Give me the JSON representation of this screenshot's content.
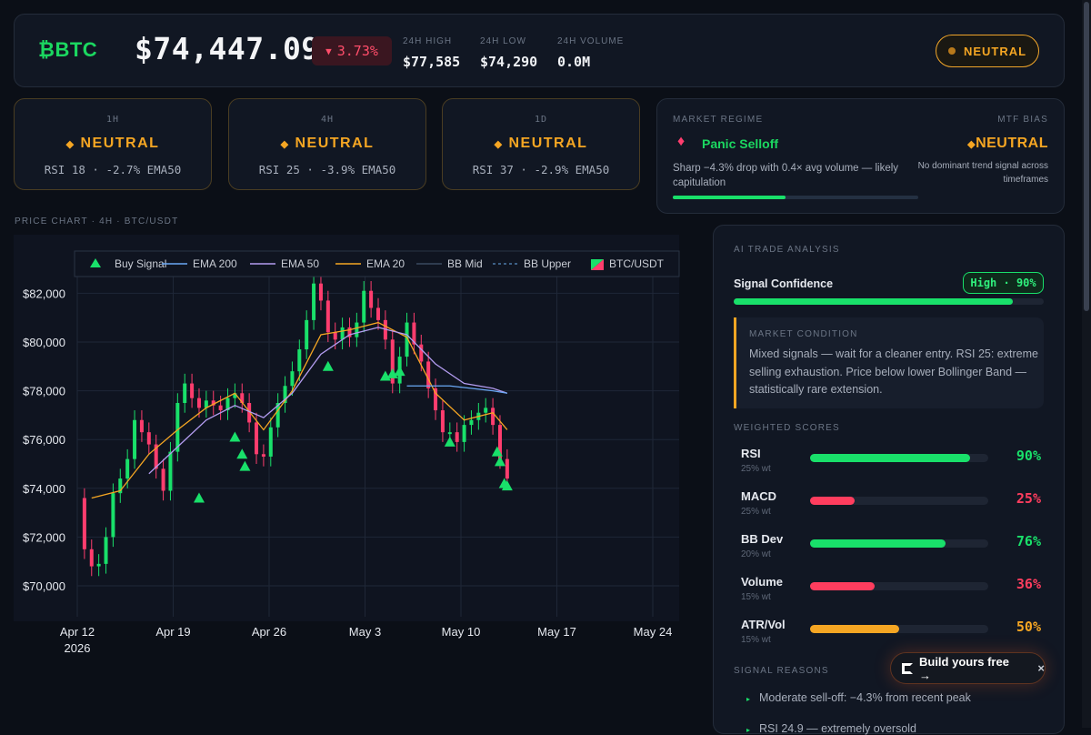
{
  "header": {
    "symbol": "BTC",
    "price": "$74,447.09",
    "change": "3.73%",
    "stats": [
      {
        "label": "24H HIGH",
        "value": "$77,585"
      },
      {
        "label": "24H LOW",
        "value": "$74,290"
      },
      {
        "label": "24H VOLUME",
        "value": "0.0M"
      }
    ],
    "bias_badge": "NEUTRAL"
  },
  "timeframes": [
    {
      "tf": "1H",
      "signal": "NEUTRAL",
      "detail": "RSI 18 · -2.7% EMA50"
    },
    {
      "tf": "4H",
      "signal": "NEUTRAL",
      "detail": "RSI 25 · -3.9% EMA50"
    },
    {
      "tf": "1D",
      "signal": "NEUTRAL",
      "detail": "RSI 37 · -2.9% EMA50"
    }
  ],
  "regime": {
    "title": "MARKET REGIME",
    "name": "Panic Selloff",
    "description": "Sharp −4.3% drop with 0.4× avg volume — likely capitulation",
    "progress": 0.46,
    "mtf_title": "MTF BIAS",
    "mtf_value": "NEUTRAL",
    "mtf_note": "No dominant trend signal across timeframes"
  },
  "chart_title": "PRICE CHART · 4H · BTC/USDT",
  "chart_data": {
    "type": "line",
    "title": "",
    "xlabel": "",
    "ylabel": "",
    "x_ticks": [
      "Apr 12",
      "Apr 19",
      "Apr 26",
      "May 3",
      "May 10",
      "May 17",
      "May 24"
    ],
    "x_tick_sub": "2026",
    "y_ticks": [
      "$70,000",
      "$72,000",
      "$74,000",
      "$76,000",
      "$78,000",
      "$80,000",
      "$82,000"
    ],
    "ylim": [
      69000,
      83500
    ],
    "xlim": [
      0,
      42
    ],
    "legend": [
      "Buy Signal",
      "EMA 200",
      "EMA 50",
      "EMA 20",
      "BB Mid",
      "BB Upper",
      "BTC/USDT"
    ],
    "legend_position": "top",
    "series": [
      {
        "name": "BTC/USDT",
        "values": [
          [
            0,
            73600
          ],
          [
            0.5,
            71500
          ],
          [
            1,
            70800
          ],
          [
            1.5,
            70900
          ],
          [
            2,
            72000
          ],
          [
            2.5,
            73800
          ],
          [
            3,
            74400
          ],
          [
            3.5,
            75200
          ],
          [
            4,
            76800
          ],
          [
            4.5,
            76300
          ],
          [
            5,
            75800
          ],
          [
            5.5,
            74800
          ],
          [
            6,
            73900
          ],
          [
            6.5,
            75500
          ],
          [
            7,
            77500
          ],
          [
            7.5,
            78300
          ],
          [
            8,
            77700
          ],
          [
            8.5,
            77300
          ],
          [
            9,
            77600
          ],
          [
            9.5,
            77400
          ],
          [
            10,
            77200
          ],
          [
            10.5,
            77700
          ],
          [
            11,
            77900
          ],
          [
            11.5,
            77500
          ],
          [
            12,
            76700
          ],
          [
            12.5,
            75400
          ],
          [
            13,
            75300
          ],
          [
            13.5,
            76500
          ],
          [
            14,
            77500
          ],
          [
            14.5,
            78200
          ],
          [
            15,
            78800
          ],
          [
            15.5,
            79700
          ],
          [
            16,
            80900
          ],
          [
            16.5,
            82400
          ],
          [
            17,
            81700
          ],
          [
            17.5,
            80400
          ],
          [
            18,
            80100
          ],
          [
            18.5,
            80600
          ],
          [
            19,
            80200
          ],
          [
            19.5,
            80800
          ],
          [
            20,
            82100
          ],
          [
            20.5,
            81400
          ],
          [
            21,
            80900
          ],
          [
            21.5,
            80100
          ],
          [
            22,
            78300
          ],
          [
            22.5,
            79400
          ],
          [
            23,
            80800
          ],
          [
            23.5,
            79900
          ],
          [
            24,
            79200
          ],
          [
            24.5,
            78100
          ],
          [
            25,
            77200
          ],
          [
            25.5,
            76300
          ],
          [
            26,
            76300
          ],
          [
            26.5,
            75900
          ],
          [
            27,
            76600
          ],
          [
            27.5,
            76800
          ],
          [
            28,
            77100
          ],
          [
            28.5,
            77300
          ],
          [
            29,
            76600
          ],
          [
            29.5,
            75200
          ],
          [
            30,
            74400
          ]
        ]
      },
      {
        "name": "EMA 20",
        "values": [
          [
            1,
            73600
          ],
          [
            3,
            73900
          ],
          [
            5,
            75400
          ],
          [
            7,
            76400
          ],
          [
            9,
            77300
          ],
          [
            11,
            77900
          ],
          [
            13,
            76400
          ],
          [
            15,
            78000
          ],
          [
            17,
            80300
          ],
          [
            19,
            80500
          ],
          [
            21,
            80800
          ],
          [
            23,
            80200
          ],
          [
            25,
            77900
          ],
          [
            27,
            76800
          ],
          [
            29,
            77100
          ],
          [
            30,
            76400
          ]
        ]
      },
      {
        "name": "EMA 50",
        "values": [
          [
            5,
            74600
          ],
          [
            7,
            75700
          ],
          [
            9,
            76800
          ],
          [
            11,
            77400
          ],
          [
            13,
            76900
          ],
          [
            15,
            77900
          ],
          [
            17,
            79500
          ],
          [
            19,
            80300
          ],
          [
            21,
            80600
          ],
          [
            23,
            80300
          ],
          [
            25,
            79100
          ],
          [
            27,
            78300
          ],
          [
            29,
            78100
          ],
          [
            30,
            77900
          ]
        ]
      },
      {
        "name": "EMA 200",
        "values": [
          [
            23,
            78200
          ],
          [
            26,
            78200
          ],
          [
            29,
            78000
          ],
          [
            30,
            77900
          ]
        ]
      }
    ],
    "buy_signals": [
      [
        8.5,
        73600
      ],
      [
        17.5,
        79000
      ],
      [
        22,
        78700
      ],
      [
        22.5,
        78800
      ],
      [
        21.5,
        78600
      ],
      [
        11,
        76100
      ],
      [
        11.5,
        75400
      ],
      [
        11.7,
        74900
      ],
      [
        26,
        75900
      ],
      [
        29.3,
        75500
      ],
      [
        29.5,
        75100
      ],
      [
        29.8,
        74200
      ],
      [
        30,
        74100
      ]
    ]
  },
  "analysis": {
    "title": "AI TRADE ANALYSIS",
    "confidence_label": "Signal Confidence",
    "confidence_value": "High · 90%",
    "confidence_pct": 0.9,
    "condition_title": "MARKET CONDITION",
    "condition_text": "Mixed signals — wait for a cleaner entry. RSI 25: extreme selling exhaustion. Price below lower Bollinger Band — statistically rare extension.",
    "scores_title": "WEIGHTED SCORES",
    "scores": [
      {
        "name": "RSI",
        "weight": "25% wt",
        "value": "90%",
        "level": 0.9,
        "color": "#19e06a"
      },
      {
        "name": "MACD",
        "weight": "25% wt",
        "value": "25%",
        "level": 0.25,
        "color": "#ff3d5e"
      },
      {
        "name": "BB Dev",
        "weight": "20% wt",
        "value": "76%",
        "level": 0.76,
        "color": "#19e06a"
      },
      {
        "name": "Volume",
        "weight": "15% wt",
        "value": "36%",
        "level": 0.36,
        "color": "#ff3d5e"
      },
      {
        "name": "ATR/Vol",
        "weight": "15% wt",
        "value": "50%",
        "level": 0.5,
        "color": "#f5a623"
      }
    ],
    "reasons_title": "SIGNAL REASONS",
    "reasons": [
      "Moderate sell-off: −4.3% from recent peak",
      "RSI 24.9 — extremely oversold"
    ]
  },
  "cta": {
    "label": "Build yours free →",
    "close": "×"
  }
}
